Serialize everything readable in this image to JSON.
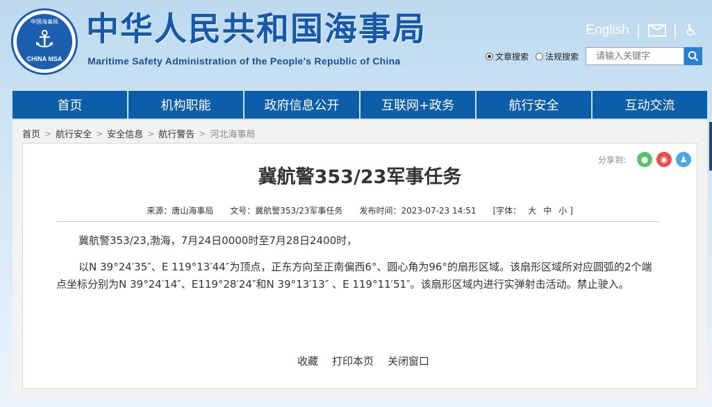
{
  "header": {
    "logo_top": "中国海事局",
    "logo_bottom": "CHINA MSA",
    "title": "中华人民共和国海事局",
    "subtitle": "Maritime Safety Administration of the People's Republic of China",
    "english_link": "English",
    "separator": "|",
    "search": {
      "option_article": "文章搜索",
      "option_law": "法规搜索",
      "placeholder": "请输入关键字"
    }
  },
  "nav": [
    "首页",
    "机构职能",
    "政府信息公开",
    "互联网+政务",
    "航行安全",
    "互动交流"
  ],
  "breadcrumb": [
    "首页",
    "航行安全",
    "安全信息",
    "航行警告",
    "河北海事局"
  ],
  "breadcrumb_arrow": ">",
  "share": {
    "label": "分享到:"
  },
  "article": {
    "title": "冀航警353/23军事任务",
    "source": "来源：唐山海事局",
    "doc_no": "文号：冀航警353/23军事任务",
    "publish_time": "发布时间：2023-07-23 14:51",
    "font_label": "[字体：",
    "font_large": "大",
    "font_medium": "中",
    "font_small": "小 ]",
    "paragraph1": "冀航警353/23,渤海，7月24日0000时至7月28日2400时，",
    "paragraph2": "以N 39°24′35″、E 119°13′44″为顶点，正东方向至正南偏西6°、圆心角为96°的扇形区域。该扇形区域所对应圆弧的2个端点坐标分别为N 39°24′14″、E119°28′24″和N 39°13′13″ 、E 119°11′51″。该扇形区域内进行实弹射击活动。禁止驶入。",
    "action_favorite": "收藏",
    "action_print": "打印本页",
    "action_close": "关闭窗口"
  },
  "colors": {
    "nav_bg": "#0d5ea8",
    "title_blue": "#1559a8"
  }
}
